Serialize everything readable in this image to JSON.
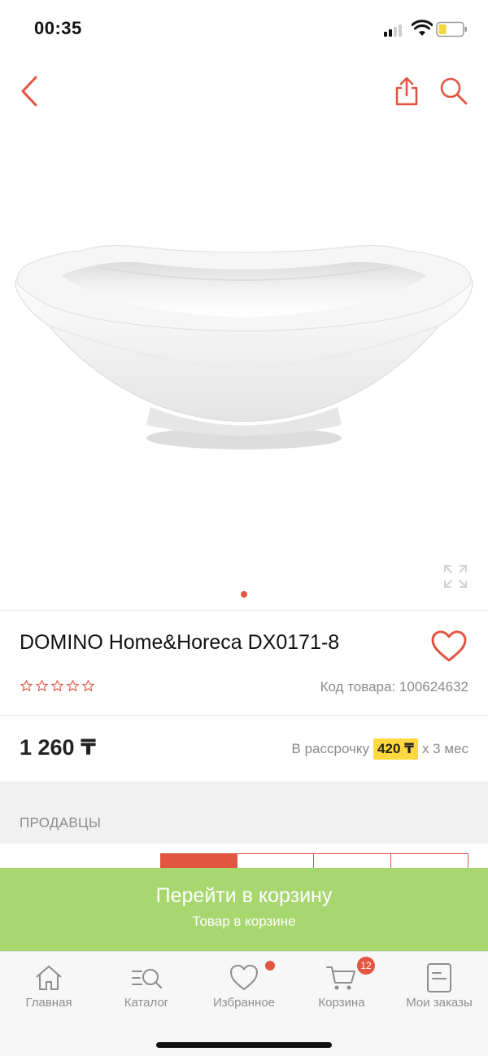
{
  "status_bar": {
    "time": "00:35"
  },
  "colors": {
    "accent": "#e25540",
    "cta_green": "#a8d770",
    "installment_yellow": "#ffd73f",
    "text_gray": "#8a8a8a"
  },
  "top_nav": {
    "back_icon": "chevron-left-icon",
    "share_icon": "share-icon",
    "search_icon": "search-icon"
  },
  "gallery": {
    "image": "white porcelain bowl",
    "expand_icon": "expand-icon",
    "slide_count": 1,
    "active_slide": 1
  },
  "product": {
    "title": "DOMINO Home&Horeca DX0171-8",
    "rating_stars": 0,
    "rating_max": 5,
    "sku_label": "Код товара: 100624632",
    "price": "1 260 ₸",
    "installment": {
      "prefix": "В рассрочку",
      "amount": "420 ₸",
      "suffix": "x 3 мес"
    }
  },
  "sellers": {
    "label": "ПРОДАВЦЫ"
  },
  "cta": {
    "title": "Перейти в корзину",
    "subtitle": "Товар в корзине"
  },
  "tab_bar": {
    "items": [
      {
        "label": "Главная",
        "icon": "home-icon"
      },
      {
        "label": "Каталог",
        "icon": "catalog-icon"
      },
      {
        "label": "Избранное",
        "icon": "heart-icon"
      },
      {
        "label": "Корзина",
        "icon": "cart-icon",
        "badge": "12"
      },
      {
        "label": "Мои заказы",
        "icon": "orders-icon"
      }
    ]
  }
}
